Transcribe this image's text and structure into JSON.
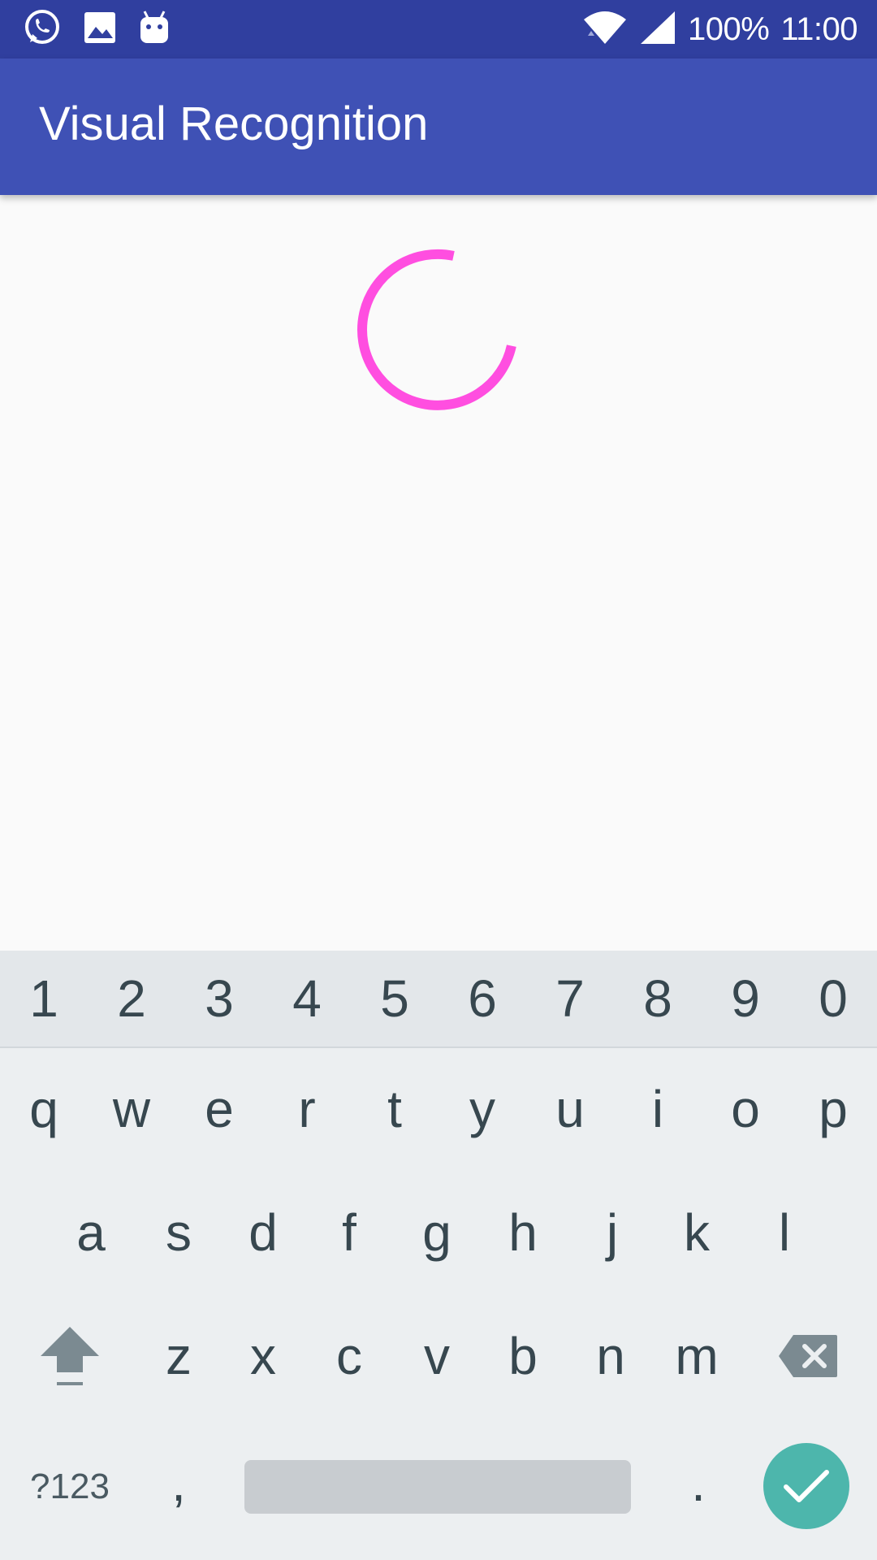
{
  "status_bar": {
    "icons_left": [
      "whatsapp-icon",
      "image-icon",
      "android-icon"
    ],
    "battery": "100%",
    "time": "11:00",
    "color": "#303f9f"
  },
  "app_bar": {
    "title": "Visual Recognition",
    "color": "#3f51b5"
  },
  "content": {
    "spinner_color": "#ff4ee0"
  },
  "keyboard": {
    "number_row": [
      "1",
      "2",
      "3",
      "4",
      "5",
      "6",
      "7",
      "8",
      "9",
      "0"
    ],
    "row1": [
      "q",
      "w",
      "e",
      "r",
      "t",
      "y",
      "u",
      "i",
      "o",
      "p"
    ],
    "row2": [
      "a",
      "s",
      "d",
      "f",
      "g",
      "h",
      "j",
      "k",
      "l"
    ],
    "row3": [
      "z",
      "x",
      "c",
      "v",
      "b",
      "n",
      "m"
    ],
    "symbols_label": "?123",
    "comma": ",",
    "period": ".",
    "enter_color": "#4db6ac"
  }
}
